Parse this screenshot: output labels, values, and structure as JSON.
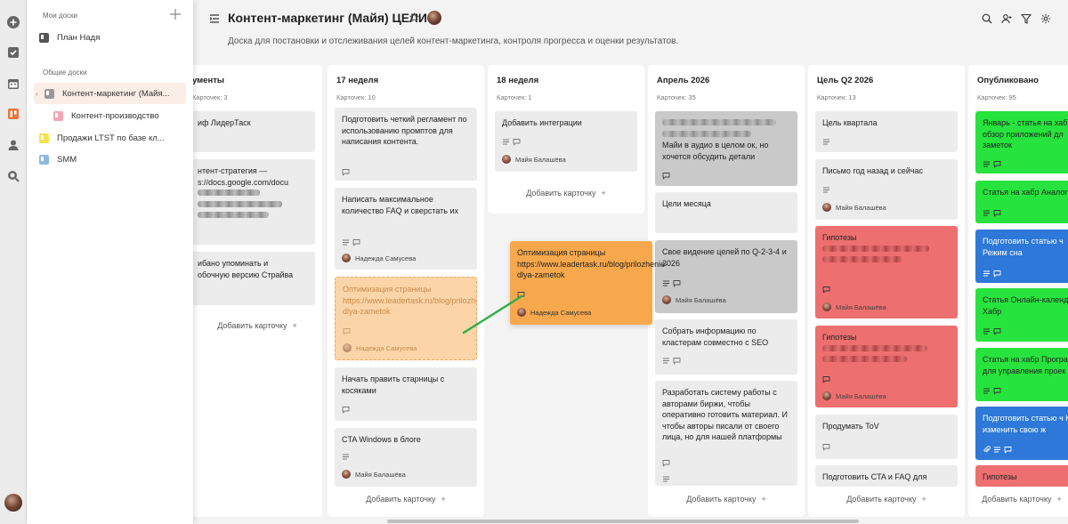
{
  "sidebar": {
    "my_boards_label": "Мои доски",
    "my_boards": [
      {
        "label": "План Надя",
        "color": "#555555"
      }
    ],
    "shared_boards_label": "Общие доски",
    "shared_boards": [
      {
        "label": "Контент-маркетинг (Майя...",
        "color": "#999999",
        "active": true
      },
      {
        "label": "Контент-производство",
        "color": "#f3a6b3",
        "sub": true
      },
      {
        "label": "Продажи LTST по базе кл...",
        "color": "#f2e34f"
      },
      {
        "label": "SMM",
        "color": "#8fb8e0"
      }
    ]
  },
  "board": {
    "title": "Контент-маркетинг (Майя) ЦЕЛИ",
    "description": "Доска для постановки и отслеживания целей контент-маркетинга, контроля прогресса и оценки результатов."
  },
  "add_card_label": "Добавить карточку",
  "columns": [
    {
      "title": "ументы",
      "count": "Карточек: 3",
      "cards": [
        {
          "text": "иф ЛидерТаск"
        },
        {
          "text": "нтент-стратегия —",
          "text2": "s://docs.google.com/docu"
        },
        {
          "text": "ибано упоминать и",
          "text2": "обочную версию Страйва"
        }
      ]
    },
    {
      "title": "17 неделя",
      "count": "Карточек: 10",
      "cards": [
        {
          "text": "Подготовить четкий регламент по использованию промптов для написания контента."
        },
        {
          "text": "Написать максимальное количество FAQ и сверстать их",
          "assignee": "Надежда Самусева"
        },
        {
          "text": "Оптимизация страницы https://www.leadertask.ru/blog/prilozhenie-dlya-zametok",
          "assignee": "Надежда Самусева"
        },
        {
          "text": "Начать править старницы с косяками"
        },
        {
          "text": "CTA Windows в блоге",
          "assignee": "Майя Балашёва"
        }
      ]
    },
    {
      "title": "18 неделя",
      "count": "Карточек: 1",
      "cards": [
        {
          "text": "Добавить интеграции",
          "assignee": "Майя Балашёва"
        }
      ]
    },
    {
      "title": "Апрель 2026",
      "count": "Карточек: 35",
      "cards": [
        {
          "text": "Майи в аудио в целом ок, но хочется обсудить детали"
        },
        {
          "text": "Цели месяца"
        },
        {
          "text": "Свое видение целей по Q-2-3-4 и 2026",
          "assignee": "Майя Балашёва"
        },
        {
          "text": "Собрать информацию по кластерам совместно с SEO"
        },
        {
          "text": "Разработать систему работы с авторами биржи, чтобы оперативно готовить материал. И чтобы авторы писали от своего лица, но для нашей платформы"
        }
      ]
    },
    {
      "title": "Цель Q2 2026",
      "count": "Карточек: 13",
      "cards": [
        {
          "text": "Цель квартала"
        },
        {
          "text": "Письмо год назад и сейчас",
          "assignee": "Майя Балашёва"
        },
        {
          "text": "Гипотезы",
          "assignee": "Майя Балашёва"
        },
        {
          "text": "Гипотезы",
          "assignee": "Майя Балашёва"
        },
        {
          "text": "Продумать ToV"
        },
        {
          "text": "Подготовить CTA и FAQ для"
        }
      ]
    },
    {
      "title": "Опубликовано",
      "count": "Карточек: 95",
      "cards": [
        {
          "text": "Январь - статья на хаб обзор приложений дл заметок"
        },
        {
          "text": "Статья на хабр Аналог"
        },
        {
          "text": "Подготовить статью ч Режим сна"
        },
        {
          "text": "Статья Онлайн-календ Хабр"
        },
        {
          "text": "Статья на хабр Програ для управления проек"
        },
        {
          "text": "Подготовить статью ч Как изменить свою ж"
        },
        {
          "text": "Гипотезы"
        }
      ]
    }
  ],
  "dragged_card": {
    "text": "Оптимизация страницы https://www.leadertask.ru/blog/prilozhenie-dlya-zametok",
    "assignee": "Надежда Самусева"
  },
  "colors": {
    "accent": "#e8763e",
    "grey_card": "#c9c9c9",
    "red_card": "#ee6f6f",
    "green_card": "#27e33d",
    "blue_card": "#2d78d8",
    "orange_card": "#f7a84c"
  }
}
